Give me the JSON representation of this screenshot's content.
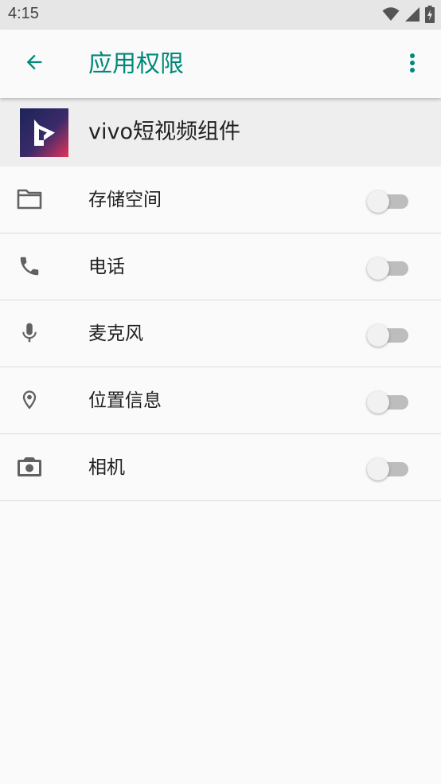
{
  "status_bar": {
    "time": "4:15",
    "icons": [
      "wifi-icon",
      "cell-signal-icon",
      "battery-charging-icon"
    ]
  },
  "app_bar": {
    "title": "应用权限",
    "back_icon": "back-arrow-icon",
    "menu_icon": "more-vert-icon",
    "accent_color": "#00897b"
  },
  "app": {
    "name": "vivo短视频组件",
    "icon": "vivo-video-app-icon"
  },
  "permissions": [
    {
      "label": "存储空间",
      "icon": "folder-icon",
      "enabled": false
    },
    {
      "label": "电话",
      "icon": "phone-icon",
      "enabled": false
    },
    {
      "label": "麦克风",
      "icon": "microphone-icon",
      "enabled": false
    },
    {
      "label": "位置信息",
      "icon": "location-pin-icon",
      "enabled": false
    },
    {
      "label": "相机",
      "icon": "camera-icon",
      "enabled": false
    }
  ]
}
